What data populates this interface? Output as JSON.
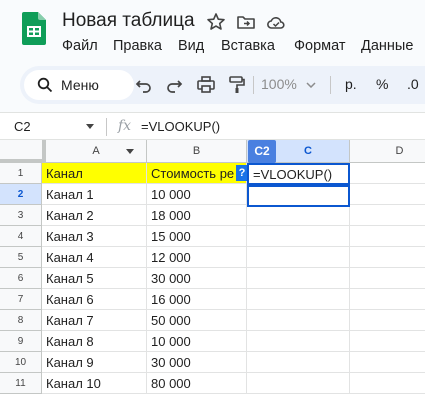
{
  "app": {
    "title": "Новая таблица",
    "brand_color": "#0f9d58",
    "accent_color": "#0b57d0"
  },
  "menu": [
    "Файл",
    "Правка",
    "Вид",
    "Вставка",
    "Формат",
    "Данные"
  ],
  "toolbar": {
    "search_label": "Меню",
    "zoom": "100%",
    "currency": "р.",
    "percent": "%",
    "decimal": ".0"
  },
  "formula_bar": {
    "cell_ref": "C2",
    "fx": "fx",
    "formula": "=VLOOKUP()"
  },
  "grid": {
    "columns": [
      "A",
      "B",
      "C",
      "D"
    ],
    "rows": [
      "1",
      "2",
      "3",
      "4",
      "5",
      "6",
      "7",
      "8",
      "9",
      "10",
      "11"
    ],
    "header": {
      "a": "Канал",
      "b": "Стоимость ре"
    },
    "data": [
      {
        "a": "Канал 1",
        "b": "10 000"
      },
      {
        "a": "Канал 2",
        "b": "18 000"
      },
      {
        "a": "Канал 3",
        "b": "15 000"
      },
      {
        "a": "Канал 4",
        "b": "12 000"
      },
      {
        "a": "Канал 5",
        "b": "30 000"
      },
      {
        "a": "Канал 6",
        "b": "16 000"
      },
      {
        "a": "Канал 7",
        "b": "50 000"
      },
      {
        "a": "Канал 8",
        "b": "10 000"
      },
      {
        "a": "Канал 9",
        "b": "30 000"
      },
      {
        "a": "Канал 10",
        "b": "80 000"
      }
    ],
    "editing_cell_value": "=VLOOKUP()",
    "selected_cell_tag": "C2",
    "help_mark": "?"
  }
}
